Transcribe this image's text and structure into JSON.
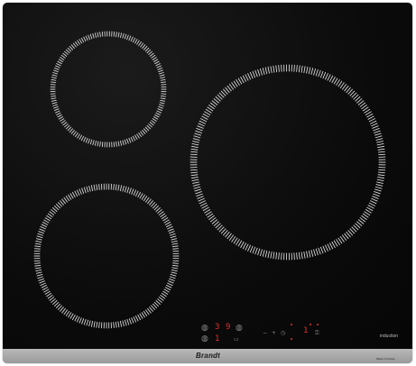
{
  "brand": "Brandt",
  "product_label": "induction",
  "model_label": "Made in France",
  "controls": {
    "top_digit_left": "3",
    "top_digit_right": "9",
    "bottom_digit_left": "1",
    "bottom_right_digit": "1",
    "minus_label": "−",
    "plus_label": "+"
  },
  "icons": [
    "zone-select-icon",
    "timer-icon",
    "lock-icon",
    "power-icon",
    "pause-icon"
  ],
  "colors": {
    "glass": "#0b0b0b",
    "frame": "#aaaaaa",
    "ring": "#d8d8d8",
    "indicator": "#e0302d"
  }
}
